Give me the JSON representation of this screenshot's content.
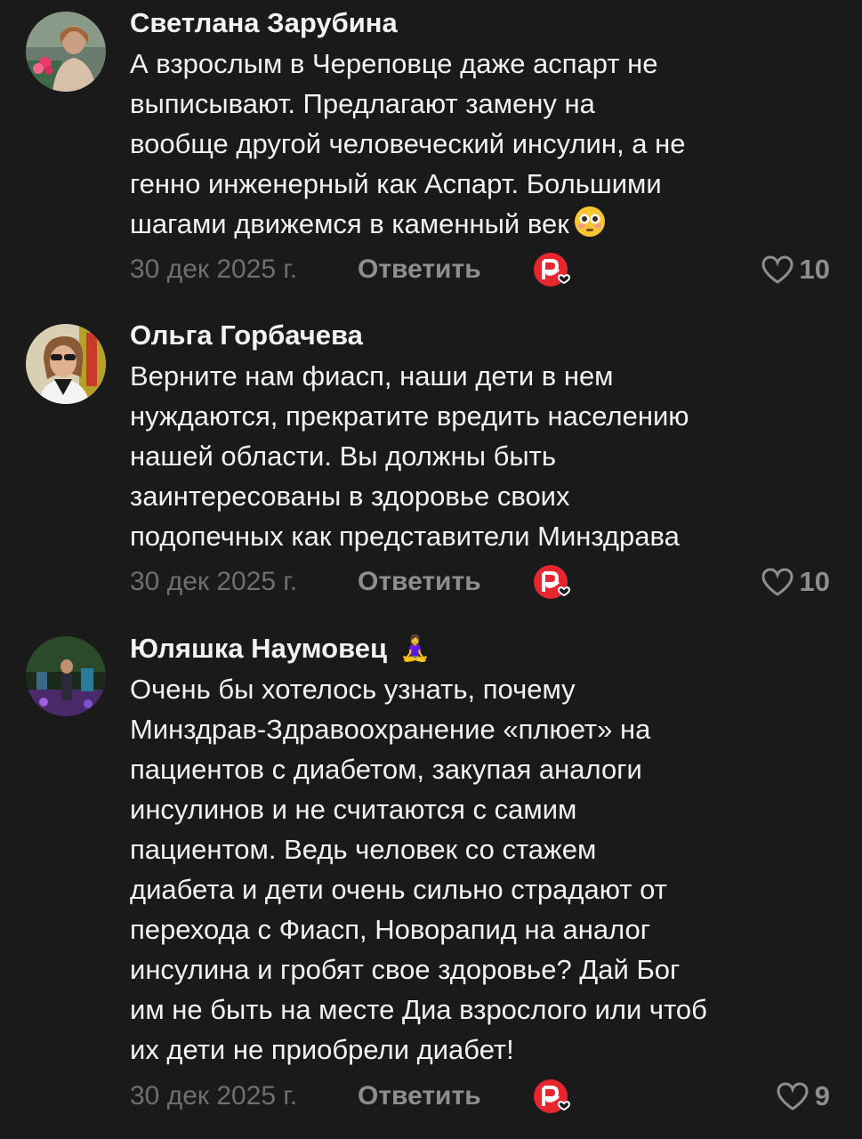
{
  "comments": [
    {
      "author": "Светлана Зарубина",
      "author_emoji": "",
      "lines": [
        "А взрослым в Череповце даже аспарт не",
        "выписывают. Предлагают замену  на",
        "вообще другой человеческий инсулин, а не",
        "генно инженерный как Аспарт. Большими",
        "шагами движемся в каменный век"
      ],
      "trailing_emoji_icon": "flushed-face-emoji",
      "date": "30 дек 2025 г.",
      "reply_label": "Ответить",
      "reaction_icon": "add-reaction-icon",
      "like_icon": "heart-outline-icon",
      "likes": "10"
    },
    {
      "author": "Ольга Горбачева",
      "author_emoji": "",
      "lines": [
        "Верните нам фиасп, наши дети в нем",
        "нуждаются, прекратите вредить населению",
        "нашей области. Вы должны быть",
        "заинтересованы в здоровье своих",
        "подопечных как представители Минздрава"
      ],
      "date": "30 дек 2025 г.",
      "reply_label": "Ответить",
      "reaction_icon": "add-reaction-icon",
      "like_icon": "heart-outline-icon",
      "likes": "10"
    },
    {
      "author": "Юляшка Наумовец",
      "author_emoji": "🧘‍♀️",
      "lines": [
        "Очень бы хотелось узнать, почему",
        "Минздрав-Здравоохранение «плюет» на",
        "пациентов с диабетом, закупая аналоги",
        "инсулинов и не считаются с самим",
        "пациентом. Ведь человек со стажем",
        "диабета и дети очень сильно страдают от",
        "перехода с Фиасп, Новорапид на аналог",
        "инсулина и гробят свое здоровье? Дай Бог",
        "им не быть на месте Диа взрослого или чтоб",
        "их дети не приобрели диабет!"
      ],
      "date": "30 дек 2025 г.",
      "reply_label": "Ответить",
      "reaction_icon": "add-reaction-icon",
      "like_icon": "heart-outline-icon",
      "likes": "9"
    }
  ],
  "colors": {
    "background": "#1a1a1a",
    "text": "#f2f2f2",
    "muted": "#6f6f6f",
    "secondary": "#8e8e8e",
    "reaction_red": "#e8262f"
  }
}
